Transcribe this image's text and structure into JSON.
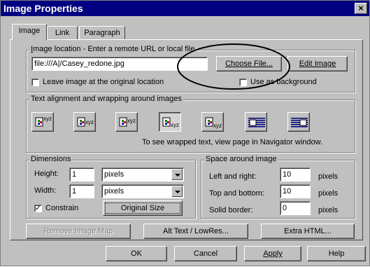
{
  "window": {
    "title": "Image Properties",
    "close_symbol": "×"
  },
  "tabs": [
    {
      "label": "Image",
      "active": true
    },
    {
      "label": "Link",
      "active": false
    },
    {
      "label": "Paragraph",
      "active": false
    }
  ],
  "image_location": {
    "legend_pre": "I",
    "legend_rest": "mage location - Enter a remote URL or local file",
    "value": "file:///A|/Casey_redone.jpg",
    "choose_file_label": "Choose File...",
    "edit_image_label": "Edit Image",
    "leave_image_label": "Leave image at the original location",
    "leave_image_checked": false,
    "use_background_label": "Use as background",
    "use_background_checked": false
  },
  "alignment": {
    "legend": "Text alignment and wrapping around images",
    "options": [
      "xyz",
      "xyz",
      "xyz",
      "xyz",
      "xyz",
      "",
      ""
    ],
    "selected_index": 3,
    "hint": "To see wrapped text, view page in Navigator window."
  },
  "dimensions": {
    "legend": "Dimensions",
    "height_label": "Height:",
    "height_value": "1",
    "height_unit": "pixels",
    "width_label": "Width:",
    "width_value": "1",
    "width_unit": "pixels",
    "constrain_label": "Constrain",
    "constrain_checked": true,
    "original_size_label": "Original Size"
  },
  "space": {
    "legend": "Space around image",
    "left_right_label": "Left and right:",
    "left_right_value": "10",
    "top_bottom_label": "Top and bottom:",
    "top_bottom_value": "10",
    "solid_border_label": "Solid border:",
    "solid_border_value": "0",
    "unit": "pixels"
  },
  "panel_buttons": {
    "remove_map": "Remove Image Map",
    "alt_text": "Alt Text / LowRes...",
    "extra_html": "Extra HTML..."
  },
  "footer_buttons": {
    "ok": "OK",
    "cancel": "Cancel",
    "apply": "Apply",
    "help": "Help"
  },
  "colors": {
    "face": "#c0c0c0",
    "titlebar": "#000080",
    "annotation": "#000000"
  }
}
